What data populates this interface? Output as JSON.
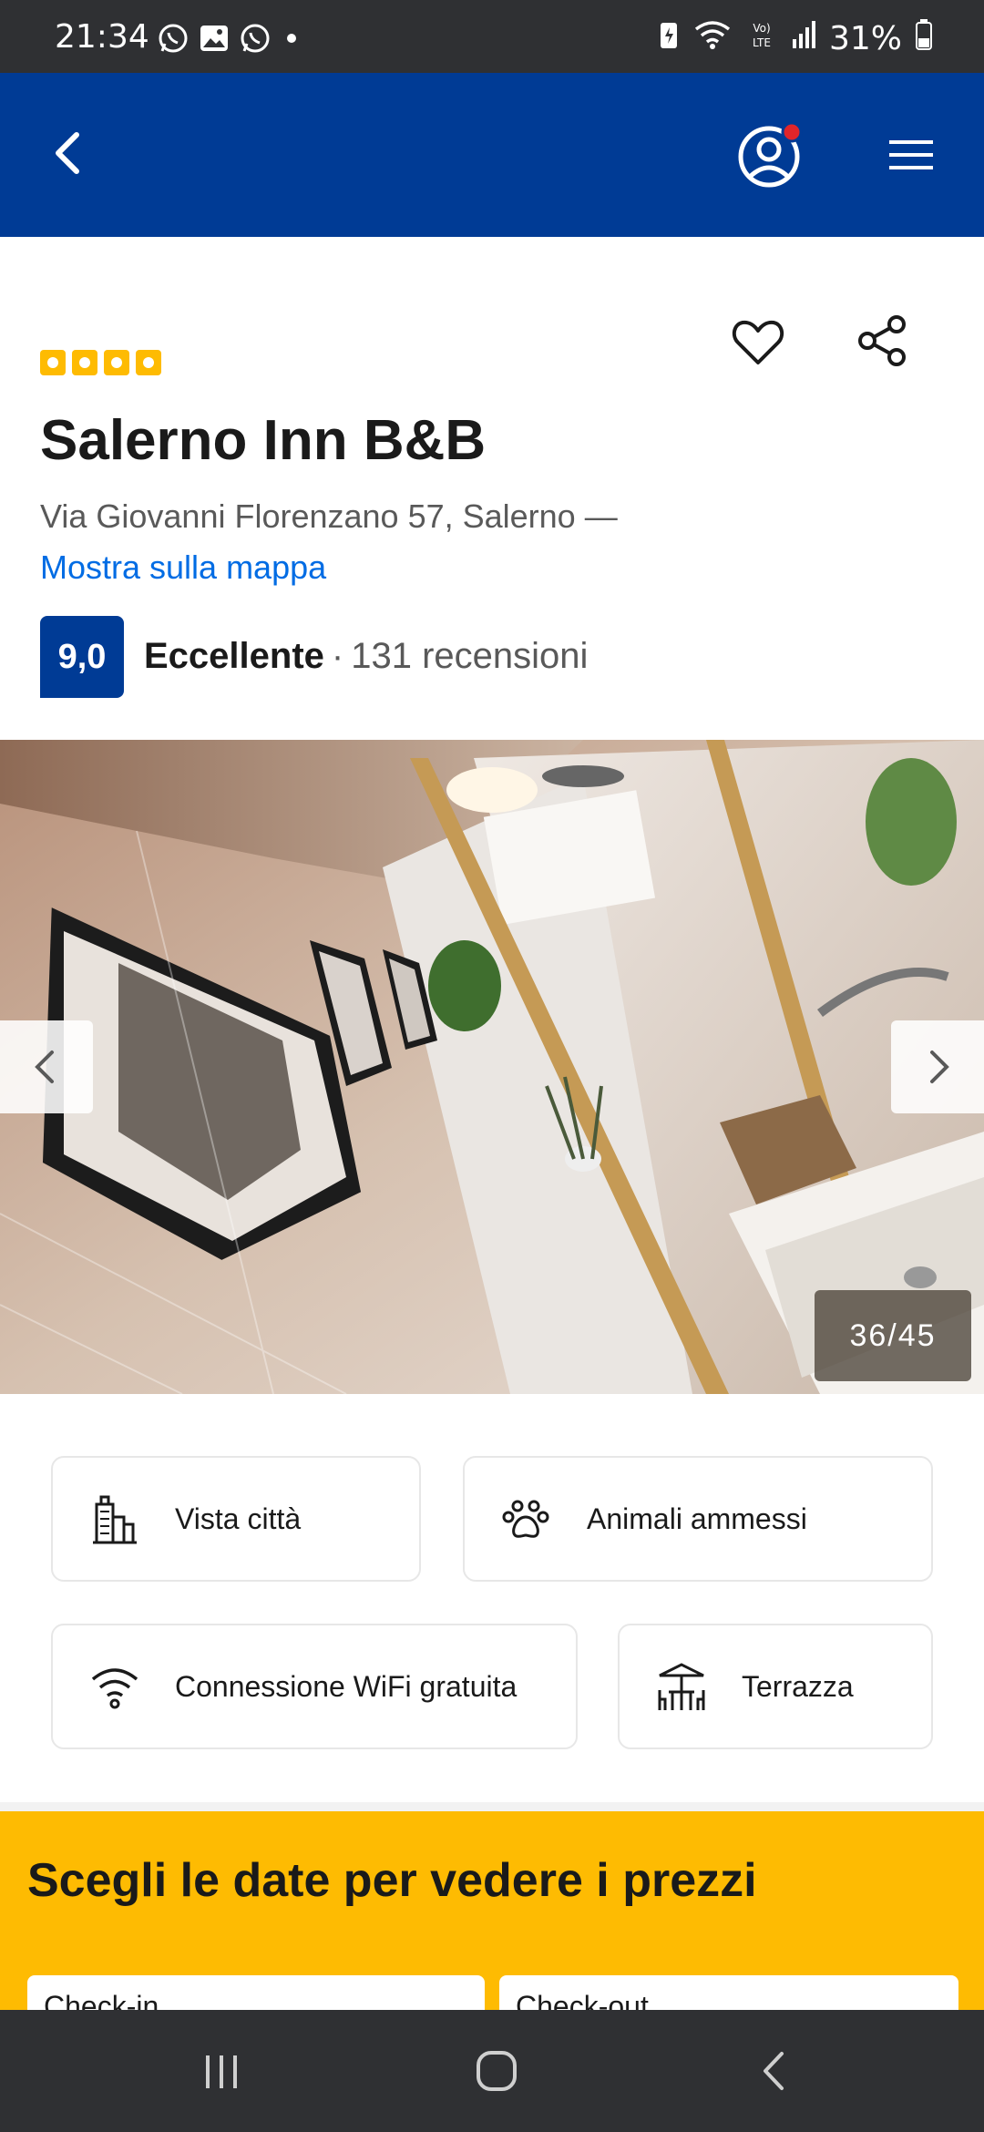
{
  "status_bar": {
    "time": "21:34",
    "battery": "31%",
    "notification_icons": [
      "whatsapp-icon",
      "gallery-icon",
      "whatsapp-icon",
      "dot"
    ],
    "system_icons": [
      "battery-saver-icon",
      "wifi-icon",
      "volte-icon",
      "signal-icon",
      "battery-icon"
    ]
  },
  "header": {
    "icons": [
      "back-arrow-icon",
      "profile-icon",
      "hamburger-menu-icon"
    ],
    "colors": {
      "brand_blue": "#003b95",
      "notification_dot": "#e0252a"
    }
  },
  "property": {
    "stars": 4,
    "name": "Salerno Inn B&B",
    "address": "Via Giovanni Florenzano 57, Salerno —",
    "map_link": "Mostra sulla mappa",
    "score": "9,0",
    "score_word": "Eccellente",
    "separator": "·",
    "reviews": "131 recensioni",
    "colors": {
      "star_yellow": "#febb02",
      "link_blue": "#006ce4"
    }
  },
  "gallery": {
    "counter": "36/45"
  },
  "facilities": [
    {
      "label": "Vista città",
      "icon": "city-view-icon"
    },
    {
      "label": "Animali ammessi",
      "icon": "paw-icon"
    },
    {
      "label": "Connessione WiFi gratuita",
      "icon": "wifi-icon"
    },
    {
      "label": "Terrazza",
      "icon": "terrace-icon"
    }
  ],
  "dates": {
    "heading": "Scegli le date per vedere i prezzi",
    "checkin_label": "Check-in",
    "checkout_label": "Check-out",
    "panel_color": "#febb02"
  },
  "system_nav": {
    "icons": [
      "recents-icon",
      "home-icon",
      "back-icon"
    ]
  }
}
